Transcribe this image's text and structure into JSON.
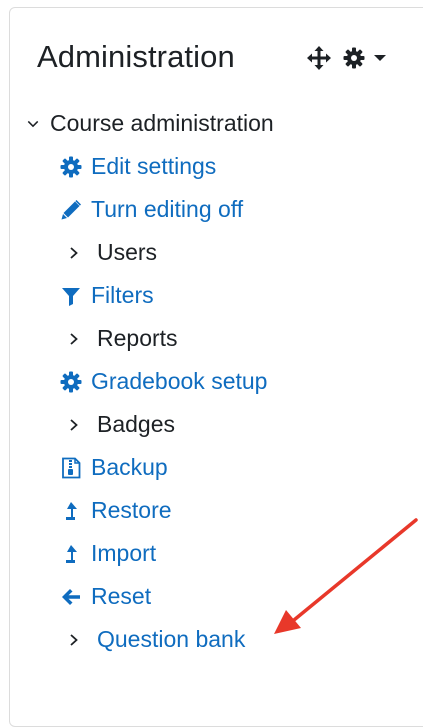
{
  "block": {
    "title": "Administration",
    "controls": {
      "move_icon": "move-arrows-icon",
      "gear_icon": "gear-icon",
      "caret_icon": "caret-down-icon"
    }
  },
  "tree": {
    "root": {
      "label": "Course administration",
      "icon": "chevron-down-icon",
      "expanded": true
    },
    "items": [
      {
        "label": "Edit settings",
        "type": "link",
        "icon": "gear-icon"
      },
      {
        "label": "Turn editing off",
        "type": "link",
        "icon": "pencil-icon"
      },
      {
        "label": "Users",
        "type": "branch",
        "icon": "chevron-right-icon"
      },
      {
        "label": "Filters",
        "type": "link",
        "icon": "filter-icon"
      },
      {
        "label": "Reports",
        "type": "branch",
        "icon": "chevron-right-icon"
      },
      {
        "label": "Gradebook setup",
        "type": "link",
        "icon": "gear-icon"
      },
      {
        "label": "Badges",
        "type": "branch",
        "icon": "chevron-right-icon"
      },
      {
        "label": "Backup",
        "type": "link",
        "icon": "backup-file-icon"
      },
      {
        "label": "Restore",
        "type": "link",
        "icon": "upload-arrow-icon"
      },
      {
        "label": "Import",
        "type": "link",
        "icon": "upload-arrow-icon"
      },
      {
        "label": "Reset",
        "type": "link",
        "icon": "arrow-left-icon"
      },
      {
        "label": "Question bank",
        "type": "branch-link",
        "icon": "chevron-right-icon"
      }
    ]
  },
  "annotation": {
    "kind": "red-arrow",
    "color": "#e8382a",
    "points_to": "Question bank"
  },
  "colors": {
    "link": "#0f6cbf",
    "text": "#1d2125",
    "border": "#dcdcdc"
  }
}
